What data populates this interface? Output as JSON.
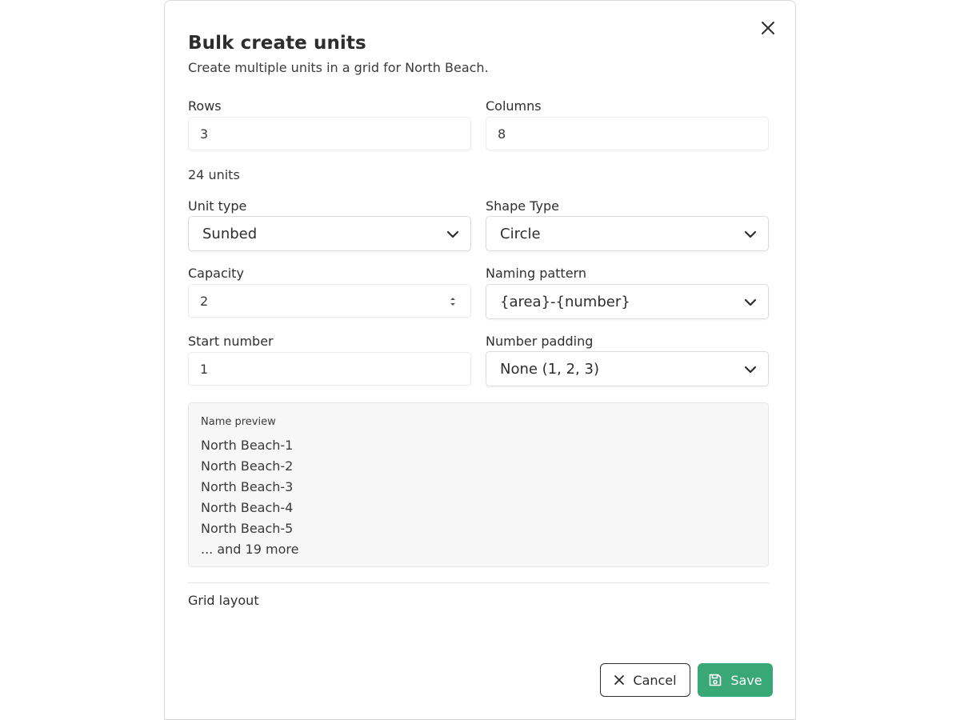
{
  "dialog": {
    "title": "Bulk create units",
    "subtitle": "Create multiple units in a grid for North Beach."
  },
  "rows": {
    "label": "Rows",
    "value": "3"
  },
  "columns": {
    "label": "Columns",
    "value": "8"
  },
  "unit_count": "24 units",
  "unit_type": {
    "label": "Unit type",
    "value": "Sunbed"
  },
  "shape_type": {
    "label": "Shape Type",
    "value": "Circle"
  },
  "capacity": {
    "label": "Capacity",
    "value": "2"
  },
  "naming_pattern": {
    "label": "Naming pattern",
    "value": "{area}-{number}"
  },
  "start_number": {
    "label": "Start number",
    "value": "1"
  },
  "number_padding": {
    "label": "Number padding",
    "value": "None (1, 2, 3)"
  },
  "preview": {
    "title": "Name preview",
    "items": [
      "North Beach-1",
      "North Beach-2",
      "North Beach-3",
      "North Beach-4",
      "North Beach-5"
    ],
    "more": "... and 19 more"
  },
  "grid_layout": {
    "label": "Grid layout"
  },
  "actions": {
    "cancel": "Cancel",
    "save": "Save"
  },
  "colors": {
    "accent": "#3aa776",
    "text": "#2d2d2d"
  },
  "icons": {
    "close": "close-icon",
    "chevron": "chevron-down-icon",
    "stepper": "stepper-icon",
    "cancel": "x-icon",
    "save": "floppy-disk-icon"
  }
}
